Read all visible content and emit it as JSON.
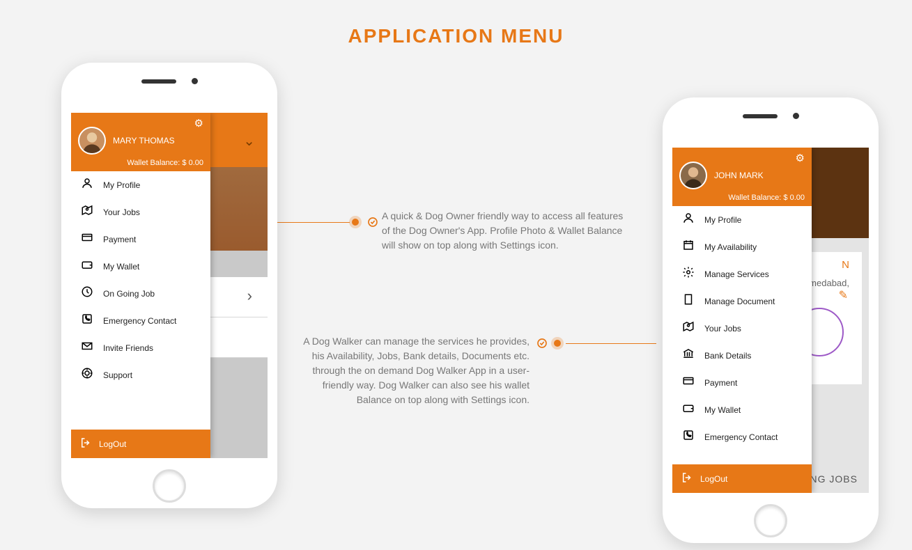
{
  "page_title": "APPLICATION MENU",
  "annotations": {
    "a1": "A quick & Dog Owner friendly way to access all features of the Dog Owner's App. Profile Photo & Wallet Balance will show on top along with Settings icon.",
    "a2": "A Dog Walker can manage the services he provides, his Availability, Jobs, Bank details, Documents etc. through the on demand Dog Walker App in a user-friendly way. Dog Walker can also see his wallet Balance on top along with Settings icon."
  },
  "left": {
    "user_name": "MARY THOMAS",
    "wallet_label": "Wallet Balance: $ 0.00",
    "menu": {
      "profile": "My Profile",
      "jobs": "Your Jobs",
      "payment": "Payment",
      "wallet": "My Wallet",
      "ongoing": "On Going Job",
      "emergency": "Emergency Contact",
      "invite": "Invite Friends",
      "support": "Support"
    },
    "logout": "LogOut"
  },
  "right": {
    "user_name": "JOHN MARK",
    "wallet_label": "Wallet Balance: $ 0.00",
    "menu": {
      "profile": "My Profile",
      "availability": "My Availability",
      "services": "Manage Services",
      "document": "Manage Document",
      "jobs": "Your Jobs",
      "bank": "Bank Details",
      "payment": "Payment",
      "wallet": "My Wallet",
      "emergency": "Emergency Contact"
    },
    "logout": "LogOut",
    "bg_card_title": "N",
    "bg_card_sub": "medabad,",
    "bg_footer": "NG JOBS"
  }
}
